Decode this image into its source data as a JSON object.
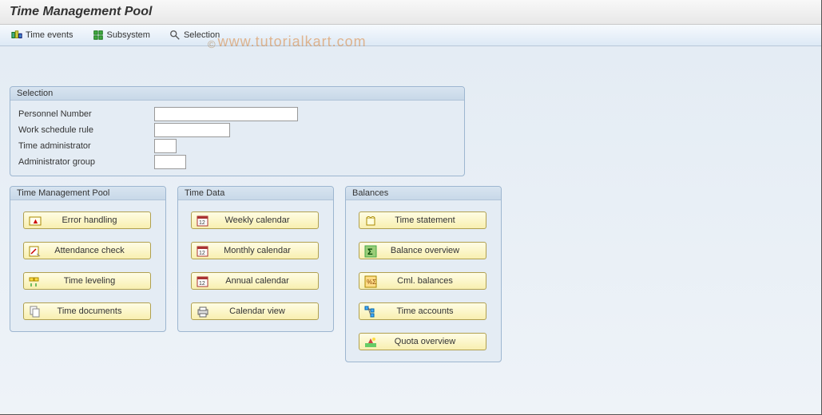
{
  "title": "Time Management Pool",
  "toolbar": {
    "time_events": "Time events",
    "subsystem": "Subsystem",
    "selection": "Selection"
  },
  "selection": {
    "title": "Selection",
    "personnel_number_label": "Personnel Number",
    "personnel_number_value": "",
    "work_schedule_label": "Work schedule rule",
    "work_schedule_value": "",
    "time_admin_label": "Time administrator",
    "time_admin_value": "",
    "admin_group_label": "Administrator group",
    "admin_group_value": ""
  },
  "pool": {
    "title": "Time Management Pool",
    "error_handling": "Error handling",
    "attendance_check": "Attendance check",
    "time_leveling": "Time leveling",
    "time_documents": "Time documents"
  },
  "timedata": {
    "title": "Time Data",
    "weekly_calendar": "Weekly calendar",
    "monthly_calendar": "Monthly calendar",
    "annual_calendar": "Annual calendar",
    "calendar_view": "Calendar view"
  },
  "balances": {
    "title": "Balances",
    "time_statement": "Time statement",
    "balance_overview": "Balance overview",
    "cml_balances": "Cml. balances",
    "time_accounts": "Time accounts",
    "quota_overview": "Quota overview"
  },
  "watermark": "www.tutorialkart.com"
}
